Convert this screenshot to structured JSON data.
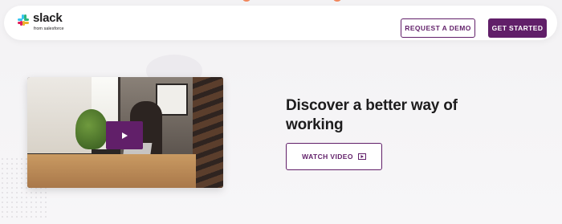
{
  "header": {
    "logo_text": "slack",
    "logo_subtext": "from salesforce",
    "request_demo_label": "REQUEST A DEMO",
    "get_started_label": "GET STARTED"
  },
  "hero": {
    "headline": "Discover a better way of working",
    "watch_video_label": "WATCH VIDEO"
  },
  "icons": {
    "logo": "slack-logo-icon",
    "play": "play-icon",
    "video": "video-play-icon"
  },
  "colors": {
    "brand_purple": "#611f69",
    "background": "#f5f4f5",
    "text": "#1d1c1d"
  }
}
